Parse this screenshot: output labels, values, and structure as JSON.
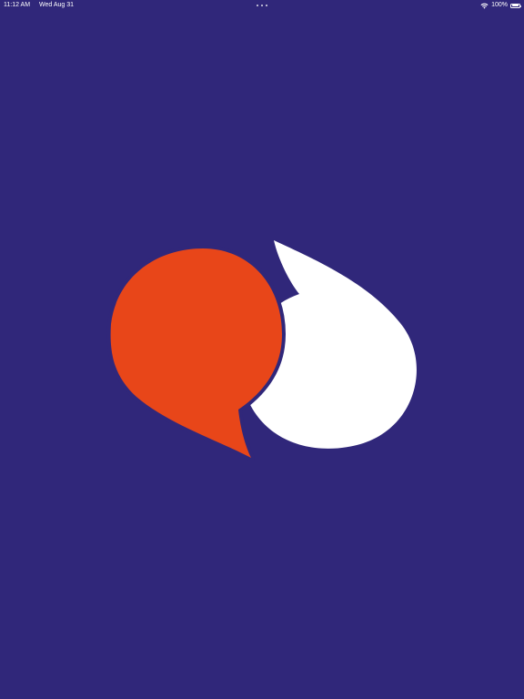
{
  "status_bar": {
    "time": "11:12 AM",
    "date": "Wed Aug 31",
    "battery_percent": "100%",
    "battery_level": 1.0,
    "wifi_icon": "wifi-icon",
    "battery_icon": "battery-icon",
    "multitask_icon": "more-dots-icon"
  },
  "splash": {
    "logo_icon": "speech-bubbles-icon"
  },
  "colors": {
    "background": "#30277a",
    "bubble_left": "#e84619",
    "bubble_right": "#ffffff",
    "status_text": "#ffffff"
  }
}
